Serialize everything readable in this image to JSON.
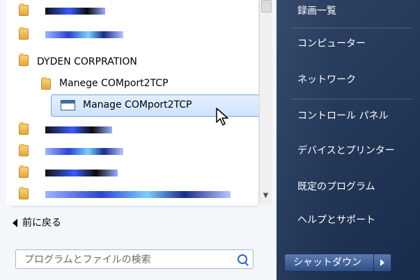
{
  "start_menu": {
    "programs": {
      "folder_1": "",
      "folder_2": "",
      "folder_dyden": "DYDEN CORPRATION",
      "subfolder_manege": "Manege COMport2TCP",
      "selected_app": "Manage COMport2TCP",
      "folder_4": "",
      "folder_5": "",
      "folder_6": "",
      "folder_7": ""
    },
    "back_label": "前に戻る",
    "search_placeholder": "プログラムとファイルの検索"
  },
  "right_pane": {
    "items": [
      "録画一覧",
      "コンピューター",
      "ネットワーク",
      "コントロール パネル",
      "デバイスとプリンター",
      "既定のプログラム",
      "ヘルプとサポート"
    ],
    "shutdown_label": "シャットダウン"
  }
}
